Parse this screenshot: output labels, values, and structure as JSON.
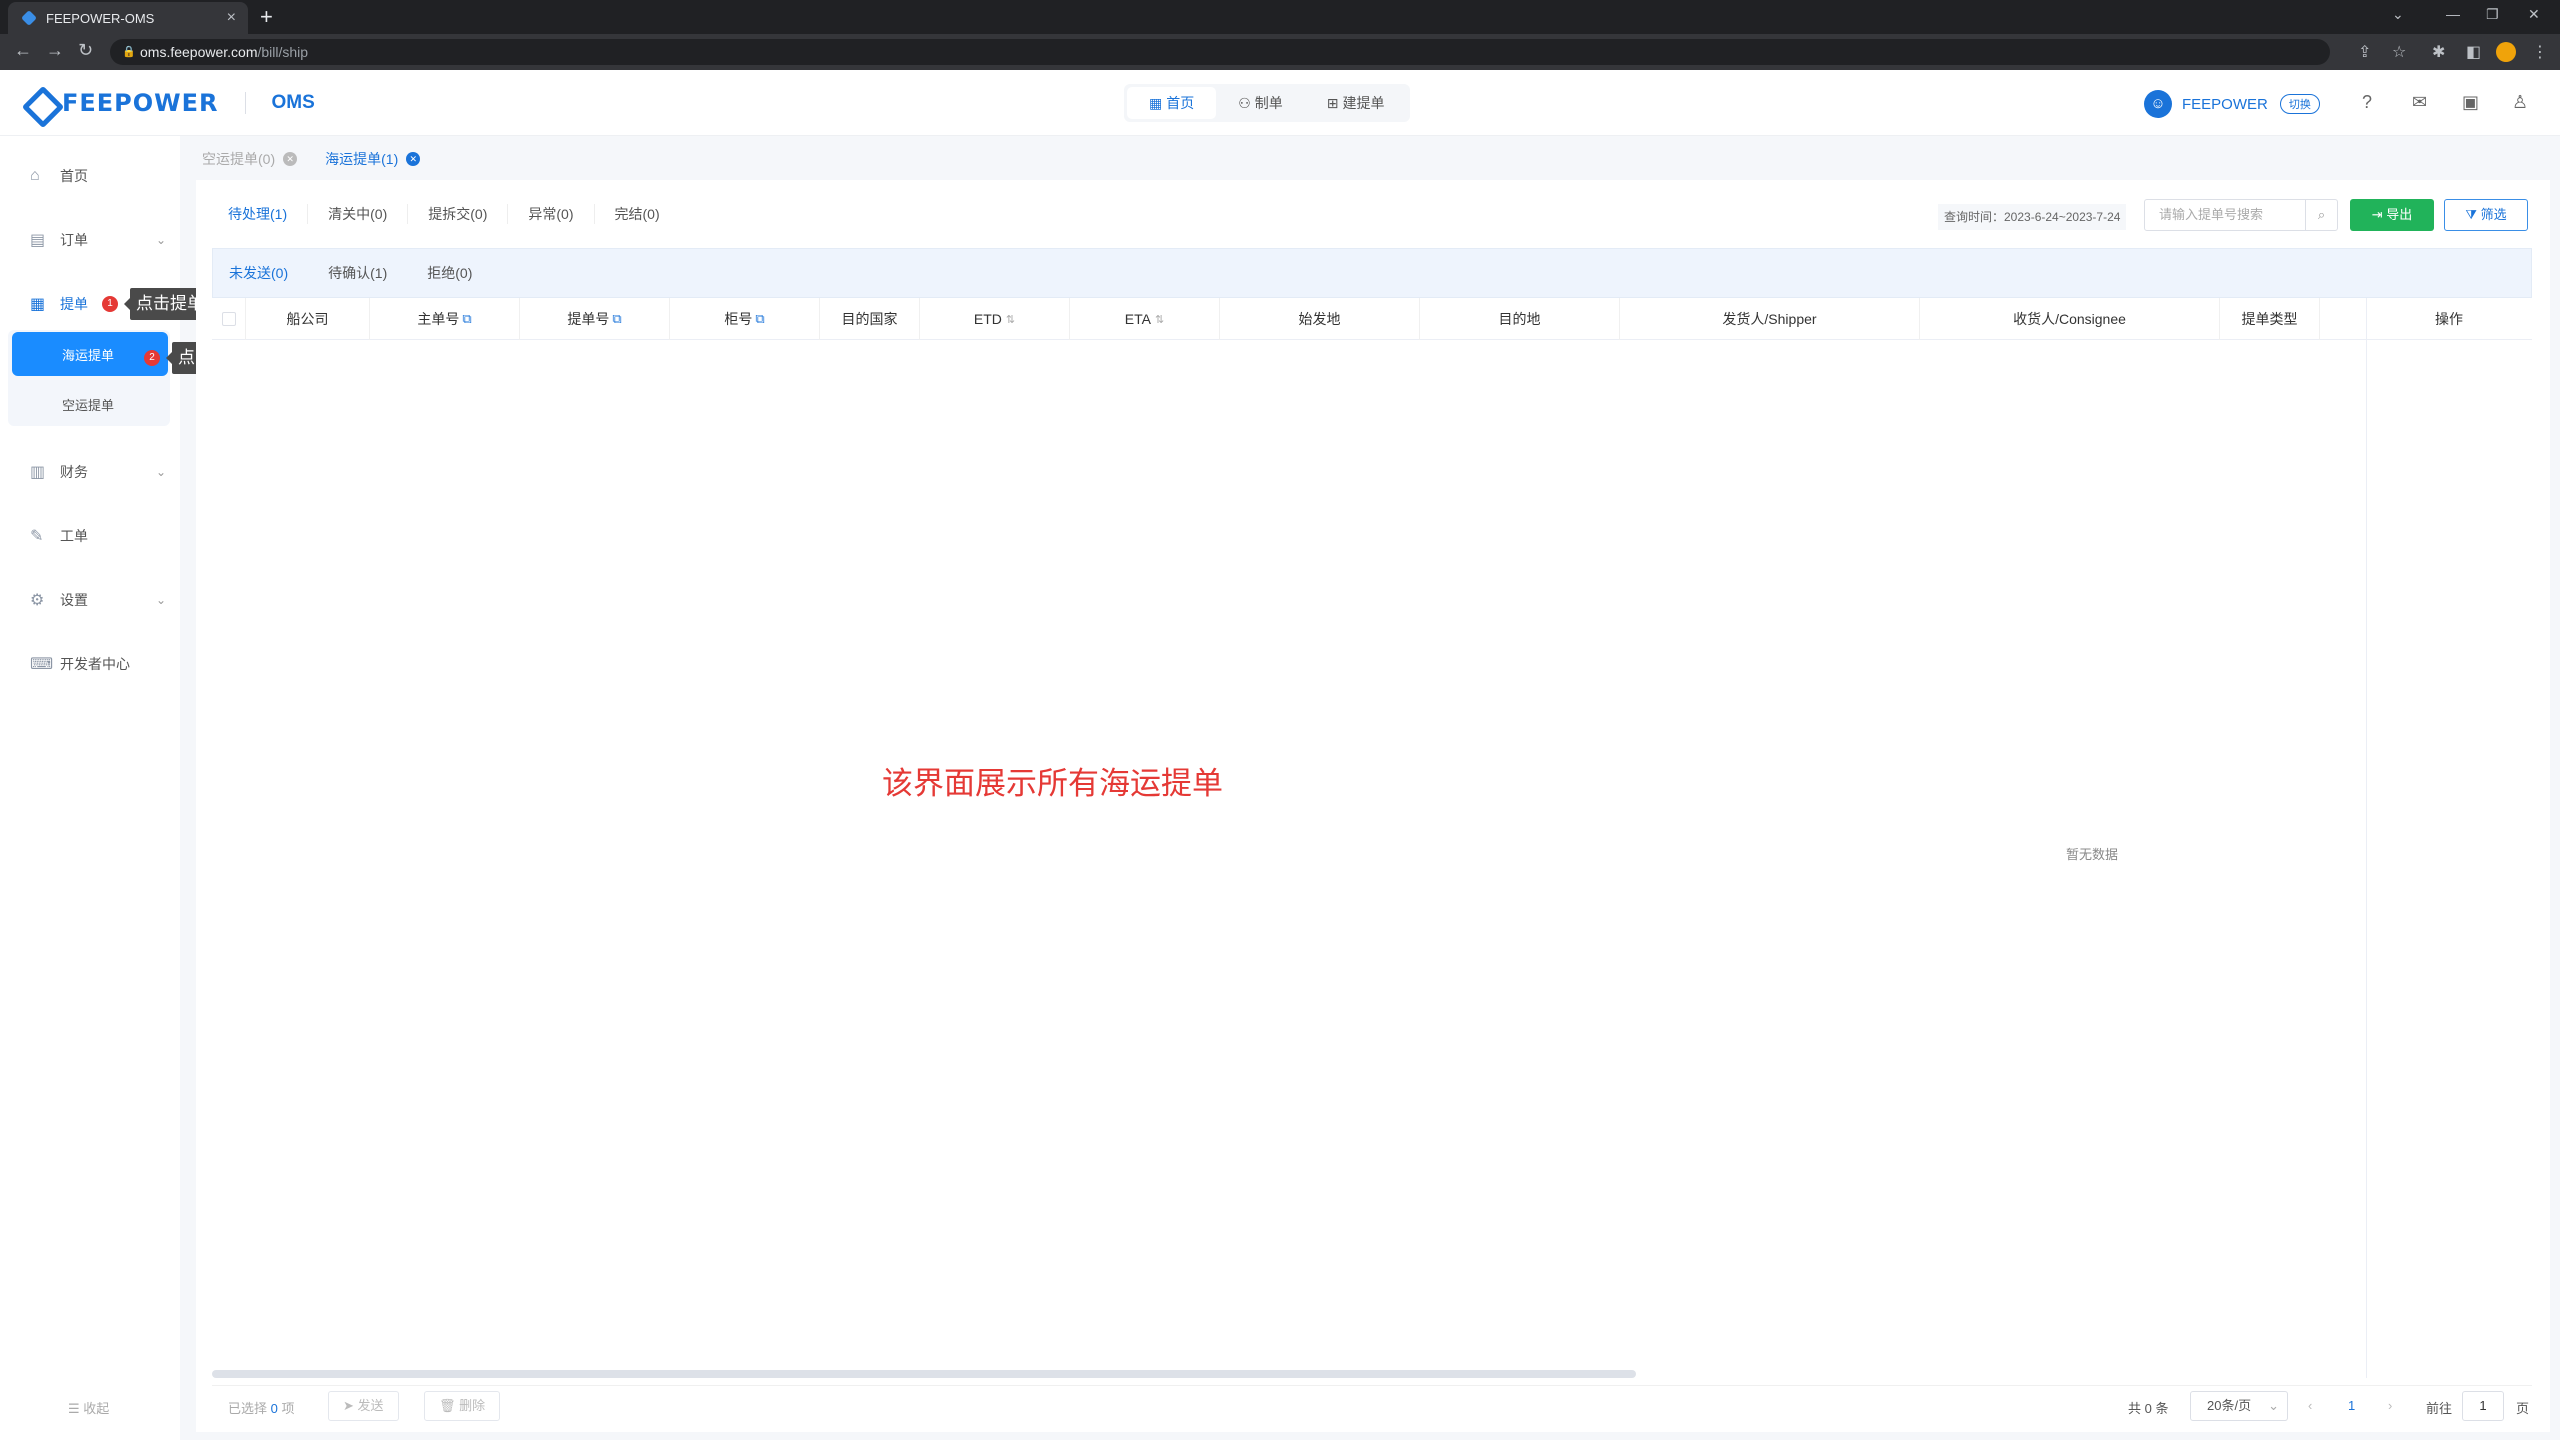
{
  "browser": {
    "tab_title": "FEEPOWER-OMS",
    "url_host": "oms.feepower.com",
    "url_path": "/bill/ship"
  },
  "header": {
    "logo_text": "FEEPOWER",
    "logo_sub": "OMS",
    "nav": [
      {
        "label": "首页",
        "icon": "grid-icon"
      },
      {
        "label": "制单",
        "icon": "user-doc-icon"
      },
      {
        "label": "建提单",
        "icon": "add-doc-icon"
      }
    ],
    "user_name": "FEEPOWER",
    "switch_label": "切换"
  },
  "sidebar": {
    "items": [
      {
        "label": "首页",
        "icon": "home-icon"
      },
      {
        "label": "订单",
        "icon": "order-icon"
      },
      {
        "label": "提单",
        "icon": "bill-icon"
      },
      {
        "label": "财务",
        "icon": "finance-icon"
      },
      {
        "label": "工单",
        "icon": "ticket-icon"
      },
      {
        "label": "设置",
        "icon": "settings-icon"
      },
      {
        "label": "开发者中心",
        "icon": "developer-icon"
      }
    ],
    "sub_items": [
      {
        "label": "海运提单"
      },
      {
        "label": "空运提单"
      }
    ],
    "collapse_label": "收起"
  },
  "annotations": {
    "step1_number": "1",
    "step1_text": "点击提单",
    "step2_number": "2",
    "step2_text": "点击海运提单",
    "main_note": "该界面展示所有海运提单"
  },
  "page_tabs": [
    {
      "label": "空运提单(0)"
    },
    {
      "label": "海运提单(1)"
    }
  ],
  "status_tabs": [
    "待处理(1)",
    "清关中(0)",
    "提拆交(0)",
    "异常(0)",
    "完结(0)"
  ],
  "toolbar": {
    "query_time": "查询时间：2023-6-24~2023-7-24",
    "search_placeholder": "请输入提单号搜索",
    "export_label": "导出",
    "filter_label": "筛选"
  },
  "sub_tabs": [
    "未发送(0)",
    "待确认(1)",
    "拒绝(0)"
  ],
  "table": {
    "columns": [
      "船公司",
      "主单号",
      "提单号",
      "柜号",
      "目的国家",
      "ETD",
      "ETA",
      "始发地",
      "目的地",
      "发货人/Shipper",
      "收货人/Consignee",
      "提单类型",
      "操作"
    ],
    "empty_text": "暂无数据"
  },
  "footer": {
    "selected_prefix": "已选择",
    "selected_count": "0",
    "selected_suffix": "项",
    "send_label": "发送",
    "delete_label": "删除",
    "total": "共 0 条",
    "page_size": "20条/页",
    "current_page": "1",
    "goto_label": "前往",
    "goto_value": "1",
    "page_suffix": "页"
  },
  "colors": {
    "primary": "#1a73d9",
    "active_menu": "#1a8cff",
    "export_green": "#21b35a",
    "annotation_red": "#e53935"
  }
}
